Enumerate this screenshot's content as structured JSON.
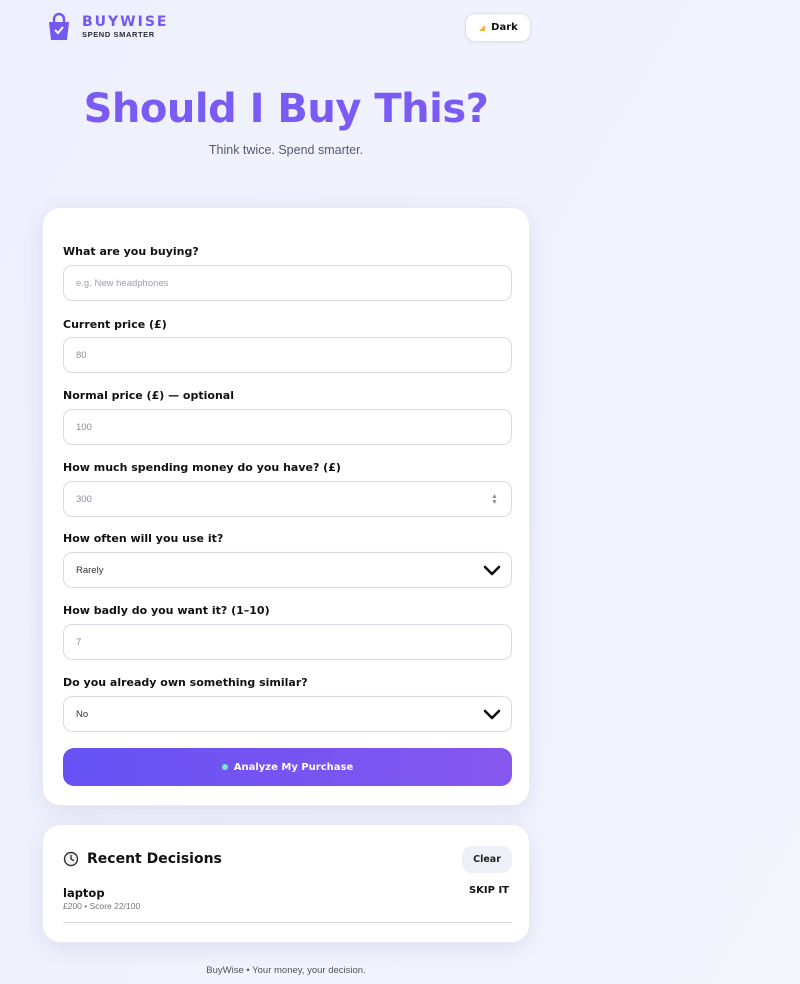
{
  "brand": {
    "name": "BUYWISE",
    "tagline": "SPEND SMARTER"
  },
  "theme_toggle": {
    "label": "Dark"
  },
  "hero": {
    "title": "Should I Buy This?",
    "subtitle": "Think twice. Spend smarter."
  },
  "form": {
    "item": {
      "label": "What are you buying?",
      "placeholder": "e.g. New headphones"
    },
    "current_price": {
      "label": "Current price (£)",
      "value": "80"
    },
    "normal_price": {
      "label": "Normal price (£) — optional",
      "value": "100"
    },
    "spending_money": {
      "label": "How much spending money do you have? (£)",
      "value": "300"
    },
    "usage": {
      "label": "How often will you use it?",
      "selected": "Rarely"
    },
    "desire": {
      "label": "How badly do you want it? (1–10)",
      "value": "7"
    },
    "own_similar": {
      "label": "Do you already own something similar?",
      "selected": "No"
    },
    "submit_label": "Analyze My Purchase"
  },
  "recent": {
    "title": "Recent Decisions",
    "clear_label": "Clear",
    "items": [
      {
        "name": "laptop",
        "meta": "£200 • Score 22/100",
        "verdict": "SKIP IT"
      }
    ]
  },
  "footer": "BuyWise • Your money, your decision.",
  "colors": {
    "accent": "#7a5cf5",
    "button_start": "#6652f4",
    "button_end": "#8557ef"
  }
}
